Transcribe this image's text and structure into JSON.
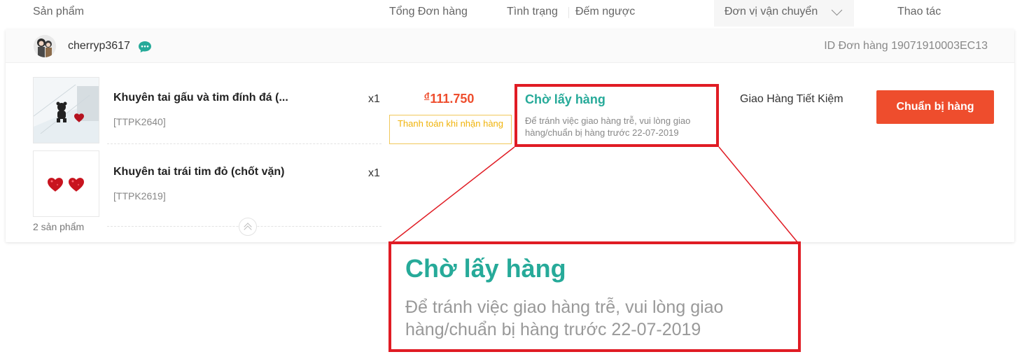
{
  "header": {
    "products": "Sản phẩm",
    "order_total": "Tổng Đơn hàng",
    "status": "Tình trạng",
    "countdown": "Đếm ngược",
    "carrier": "Đơn vị vận chuyển",
    "actions": "Thao tác"
  },
  "order": {
    "buyer": "cherryp3617",
    "order_id": "ID Đơn hàng 19071910003EC13",
    "products": [
      {
        "name": "Khuyên tai gấu và tim đính đá (...",
        "sku": "[TTPK2640]",
        "qty": "x1"
      },
      {
        "name": "Khuyên tai trái tim đỏ (chốt vặn)",
        "sku": "[TTPK2619]",
        "qty": "x1"
      }
    ],
    "product_count": "2 sản phẩm",
    "currency_symbol": "đ",
    "total": "111.750",
    "payment_method": "Thanh toán khi nhận hàng",
    "status": "Chờ lấy hàng",
    "status_note": "Để tránh việc giao hàng trễ, vui lòng giao hàng/chuẩn bị hàng trước 22-07-2019",
    "carrier": "Giao Hàng Tiết Kiệm",
    "action_button": "Chuẩn bị hàng"
  },
  "callout": {
    "status": "Chờ lấy hàng",
    "note": "Để tránh việc giao hàng trễ, vui lòng giao hàng/chuẩn bị hàng trước 22-07-2019"
  },
  "colors": {
    "accent": "#ee4d2d",
    "status_green": "#26aa99",
    "highlight_red": "#e01c24",
    "payment_yellow": "#f0b30a"
  },
  "icons": [
    "chat-icon",
    "chevron-down-icon",
    "collapse-up-icon"
  ]
}
